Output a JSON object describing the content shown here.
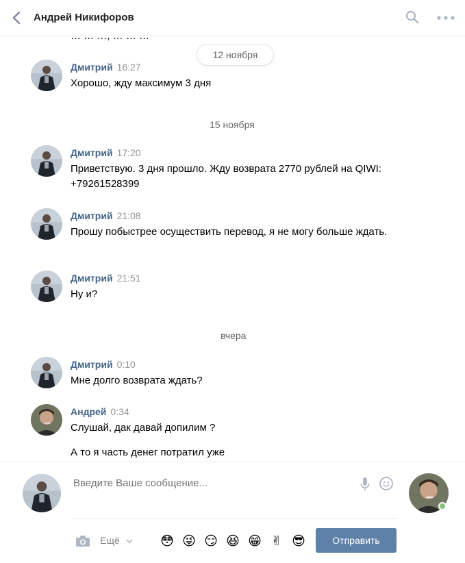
{
  "header": {
    "back_icon": "chevron-left-icon",
    "title": "Андрей Никифоров",
    "search_icon": "search-icon",
    "more_icon": "more-horizontal-icon"
  },
  "history": {
    "clipped_text": "… … …, … … …",
    "dates": [
      "12 ноября",
      "15 ноября",
      "вчера"
    ],
    "messages": [
      {
        "author": "Дмитрий",
        "time": "16:27",
        "text": "Хорошо, жду максимум 3 дня"
      },
      {
        "author": "Дмитрий",
        "time": "17:20",
        "text": "Приветствую. 3 дня прошло. Жду возврата 2770 рублей на QIWI: +79261528399"
      },
      {
        "author": "Дмитрий",
        "time": "21:08",
        "text": "Прошу побыстрее осуществить перевод, я не могу больше ждать."
      },
      {
        "author": "Дмитрий",
        "time": "21:51",
        "text": "Ну и?"
      },
      {
        "author": "Дмитрий",
        "time": "0:10",
        "text": "Мне долго возврата ждать?"
      },
      {
        "author": "Андрей",
        "time": "0:34",
        "text": "Слушай, дак давай допилим ?"
      },
      {
        "author": "",
        "time": "",
        "text": "А то я часть денег потратил уже"
      }
    ]
  },
  "composer": {
    "placeholder": "Введите Ваше сообщение...",
    "more_label": "Ещё",
    "send_label": "Отправить",
    "emojis": [
      "😳",
      "😜",
      "😏",
      "😆",
      "😁",
      "✌",
      "😎"
    ],
    "online_color": "#8ac176",
    "accent_color": "#5e81a8"
  }
}
